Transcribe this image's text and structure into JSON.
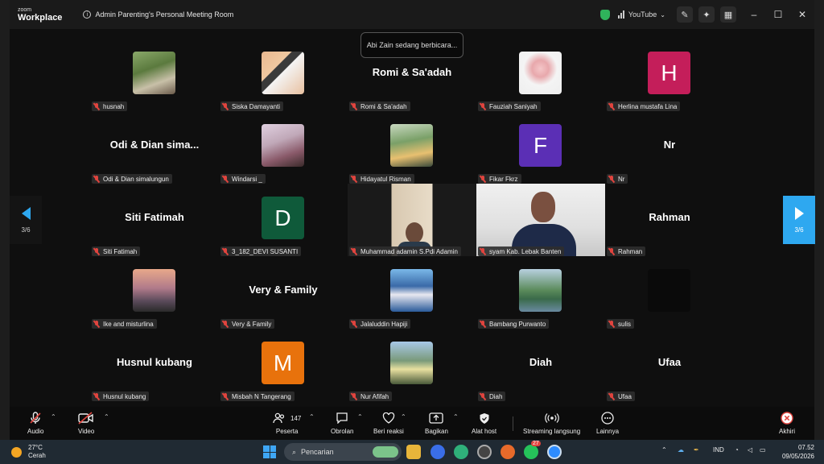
{
  "window": {
    "logo_line1": "zoom",
    "logo_line2": "Workplace",
    "meeting_title": "Admin Parenting's Personal Meeting Room",
    "streaming_label": "YouTube",
    "colors": {
      "accent": "#2ea8f0",
      "mute_red": "#e0443e",
      "secure_green": "#2fb35b"
    }
  },
  "speaking_toast": "Abi Zain sedang berbicara...",
  "pagination": {
    "left": "3/6",
    "right": "3/6"
  },
  "participants": [
    {
      "name": "husnah",
      "kind": "photo",
      "photo": "photo-group"
    },
    {
      "name": "Siska Damayanti",
      "kind": "photo",
      "photo": "photo-karate"
    },
    {
      "name": "Romi & Sa'adah",
      "kind": "text",
      "display": "Romi & Sa'adah"
    },
    {
      "name": "Fauziah Saniyah",
      "kind": "photo",
      "photo": "photo-rose"
    },
    {
      "name": "Herlina mustafa Lina",
      "kind": "letter",
      "letter": "H",
      "color": "#c41e5a"
    },
    {
      "name": "Odi & Dian simalungun",
      "kind": "text",
      "display": "Odi & Dian sima..."
    },
    {
      "name": "Windarsi _",
      "kind": "photo",
      "photo": "photo-selfie"
    },
    {
      "name": "Hidayatul Risman",
      "kind": "photo",
      "photo": "photo-couple"
    },
    {
      "name": "Fikar Fkrz",
      "kind": "letter",
      "letter": "F",
      "color": "#5b2fb5"
    },
    {
      "name": "Nr",
      "kind": "text",
      "display": "Nr"
    },
    {
      "name": "Siti Fatimah",
      "kind": "text",
      "display": "Siti Fatimah"
    },
    {
      "name": "3_182_DEVI SUSANTI",
      "kind": "letter",
      "letter": "D",
      "color": "#0f5a3a"
    },
    {
      "name": "Muhammad adamin S.Pdi Adamin",
      "kind": "video"
    },
    {
      "name": "syam Kab. Lebak Banten",
      "kind": "video"
    },
    {
      "name": "Rahman",
      "kind": "text",
      "display": "Rahman"
    },
    {
      "name": "Ike and misturlina",
      "kind": "photo",
      "photo": "photo-sunset"
    },
    {
      "name": "Very & Family",
      "kind": "text",
      "display": "Very & Family"
    },
    {
      "name": "Jalaluddin Hapiji",
      "kind": "photo",
      "photo": "photo-poster"
    },
    {
      "name": "Bambang Purwanto",
      "kind": "photo",
      "photo": "photo-lake"
    },
    {
      "name": "sulis",
      "kind": "photo",
      "photo": "photo-dark"
    },
    {
      "name": "Husnul kubang",
      "kind": "text",
      "display": "Husnul kubang"
    },
    {
      "name": "Misbah N Tangerang",
      "kind": "letter",
      "letter": "M",
      "color": "#e8720c"
    },
    {
      "name": "Nur Afifah",
      "kind": "photo",
      "photo": "photo-mountain"
    },
    {
      "name": "Diah",
      "kind": "text",
      "display": "Diah"
    },
    {
      "name": "Ufaa",
      "kind": "text",
      "display": "Ufaa"
    }
  ],
  "toolbar": {
    "audio": "Audio",
    "video": "Video",
    "participants": "Peserta",
    "participant_count": "147",
    "chat": "Obrolan",
    "reactions": "Beri reaksi",
    "share": "Bagikan",
    "host_tools": "Alat host",
    "live_streaming": "Streaming langsung",
    "more": "Lainnya",
    "end": "Akhiri"
  },
  "taskbar": {
    "temperature": "27°C",
    "weather": "Cerah",
    "search_placeholder": "Pencarian",
    "whatsapp_badge": "27",
    "language": "IND",
    "time": "07.52",
    "date": "09/05/2026"
  }
}
